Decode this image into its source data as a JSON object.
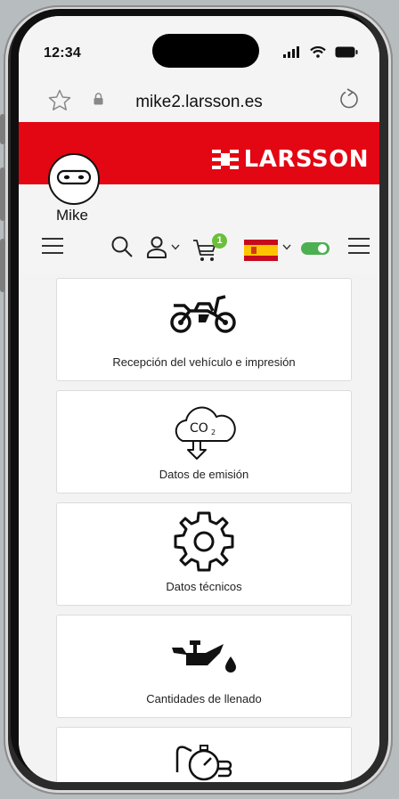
{
  "status_bar": {
    "time": "12:34"
  },
  "browser": {
    "url": "mike2.larsson.es"
  },
  "header": {
    "brand": "LARSSON",
    "brand_color": "#e30613"
  },
  "user": {
    "name": "Mike"
  },
  "nav": {
    "cart_count": "1",
    "language_flag": "spain-flag",
    "toggle_on": true,
    "toggle_color": "#4caf50"
  },
  "cards": [
    {
      "label": "Recepción del vehículo e impresión",
      "icon": "motorcycle-icon"
    },
    {
      "label": "Datos de emisión",
      "icon": "co2-cloud-icon"
    },
    {
      "label": "Datos técnicos",
      "icon": "gear-icon"
    },
    {
      "label": "Cantidades de llenado",
      "icon": "oil-can-icon"
    },
    {
      "label": "",
      "icon": "stopwatch-hand-icon"
    }
  ]
}
